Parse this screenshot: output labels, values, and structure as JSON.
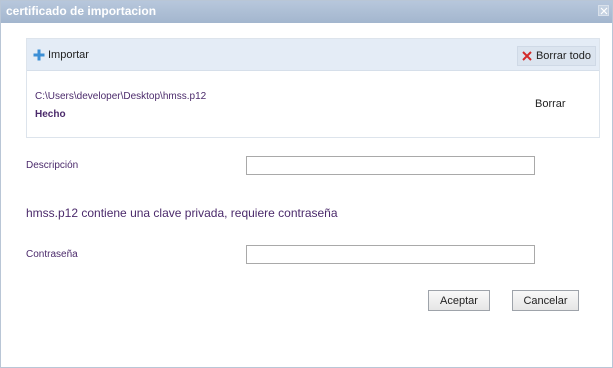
{
  "window": {
    "title": "certificado de importacion"
  },
  "toolbar": {
    "import_label": "Importar",
    "clear_all_label": "Borrar todo"
  },
  "file": {
    "path": "C:\\Users\\developer\\Desktop\\hmss.p12",
    "status": "Hecho",
    "remove_label": "Borrar"
  },
  "form": {
    "description_label": "Descripción",
    "description_value": "",
    "info_message": "hmss.p12 contiene una clave privada, requiere contraseña",
    "password_label": "Contraseña",
    "password_value": ""
  },
  "actions": {
    "accept_label": "Aceptar",
    "cancel_label": "Cancelar"
  },
  "colors": {
    "titlebar": "#a9bcd3",
    "toolbar": "#e4ecf6",
    "label_text": "#4b2a6b",
    "import_icon": "#3c8fd6",
    "clear_icon": "#d32a2a"
  },
  "icons": {
    "import": "plus-icon",
    "clear": "x-icon",
    "close": "close-icon"
  }
}
